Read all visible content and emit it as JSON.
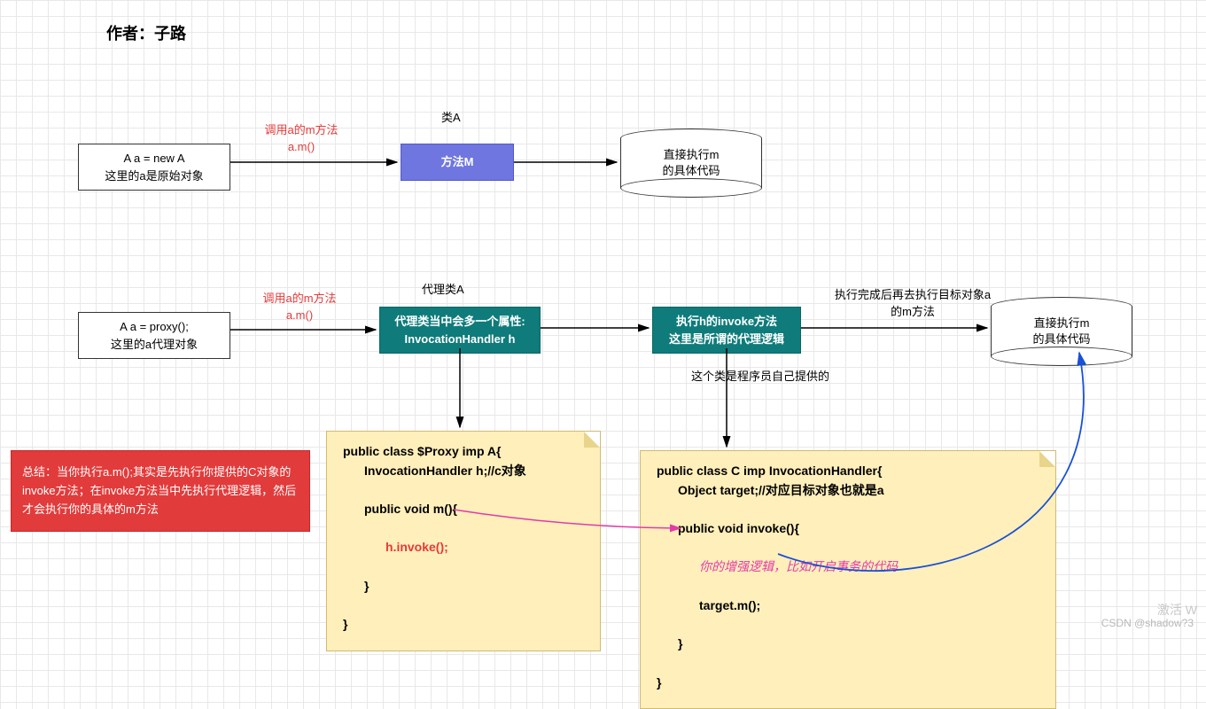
{
  "author": "作者：子路",
  "row1": {
    "box_a": {
      "l1": "A a = new A",
      "l2": "这里的a是原始对象"
    },
    "arrow1": {
      "l1": "调用a的m方法",
      "l2": "a.m()"
    },
    "classA_label": "类A",
    "methodM": "方法M",
    "cyl1": {
      "l1": "直接执行m",
      "l2": "的具体代码"
    }
  },
  "row2": {
    "box_a": {
      "l1": "A a = proxy();",
      "l2": "这里的a代理对象"
    },
    "arrow1": {
      "l1": "调用a的m方法",
      "l2": "a.m()"
    },
    "proxyA_label": "代理类A",
    "proxyBox": {
      "l1": "代理类当中会多一个属性:",
      "l2": "InvocationHandler h"
    },
    "invokeBox": {
      "l1": "执行h的invoke方法",
      "l2": "这里是所谓的代理逻辑"
    },
    "arrow3": {
      "l1": "执行完成后再去执行目标对象a",
      "l2": "的m方法"
    },
    "cyl2": {
      "l1": "直接执行m",
      "l2": "的具体代码"
    },
    "providedLabel": "这个类是程序员自己提供的"
  },
  "summary": "总结：当你执行a.m();其实是先执行你提供的C对象的invoke方法；在invoke方法当中先执行代理逻辑，然后才会执行你的具体的m方法",
  "note1": {
    "l1": "public class $Proxy imp A{",
    "l2": "InvocationHandler h;//c对象",
    "l3": "public void m(){",
    "l4": "h.invoke();",
    "l5": "}",
    "l6": "}"
  },
  "note2": {
    "l1": "public class C imp InvocationHandler{",
    "l2": "Object target;//对应目标对象也就是a",
    "l3": "public void invoke(){",
    "l4": "你的增强逻辑，比如开启事务的代码",
    "l5": "target.m();",
    "l6": "}",
    "l7": "}"
  },
  "footer": {
    "watermark": "CSDN @shadow?3",
    "activate": "激活 W"
  }
}
